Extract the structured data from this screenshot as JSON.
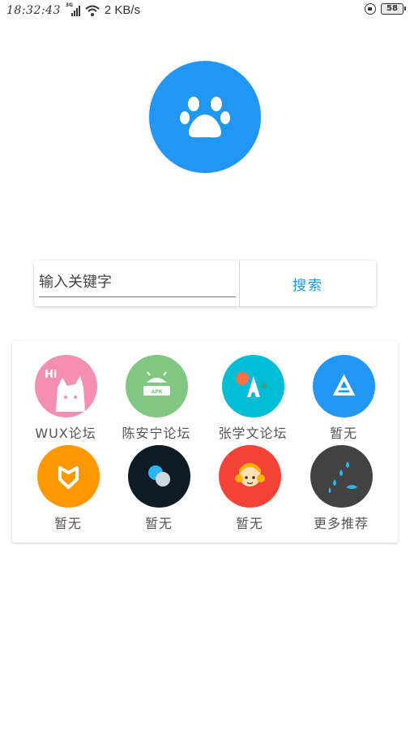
{
  "status_bar": {
    "time": "18:32:43",
    "network_type": "3G",
    "speed": "2 KB/s",
    "battery": "58"
  },
  "search": {
    "placeholder": "输入关键字",
    "button_label": "搜索"
  },
  "forums": [
    {
      "label": "WUX论坛",
      "icon": "wux-cat-icon",
      "color": "#f48fb1"
    },
    {
      "label": "陈安宁论坛",
      "icon": "android-apk-icon",
      "color": "#81c784"
    },
    {
      "label": "张学文论坛",
      "icon": "letter-a-icon",
      "color": "#00bcd4"
    },
    {
      "label": "暂无",
      "icon": "triangle-icon",
      "color": "#2196f3"
    },
    {
      "label": "暂无",
      "icon": "heart-shield-icon",
      "color": "#ff9800"
    },
    {
      "label": "暂无",
      "icon": "overlapping-circles-icon",
      "color": "#0d1b24"
    },
    {
      "label": "暂无",
      "icon": "anime-girl-icon",
      "color": "#f44336"
    },
    {
      "label": "更多推荐",
      "icon": "water-drops-icon",
      "color": "#424242"
    }
  ]
}
